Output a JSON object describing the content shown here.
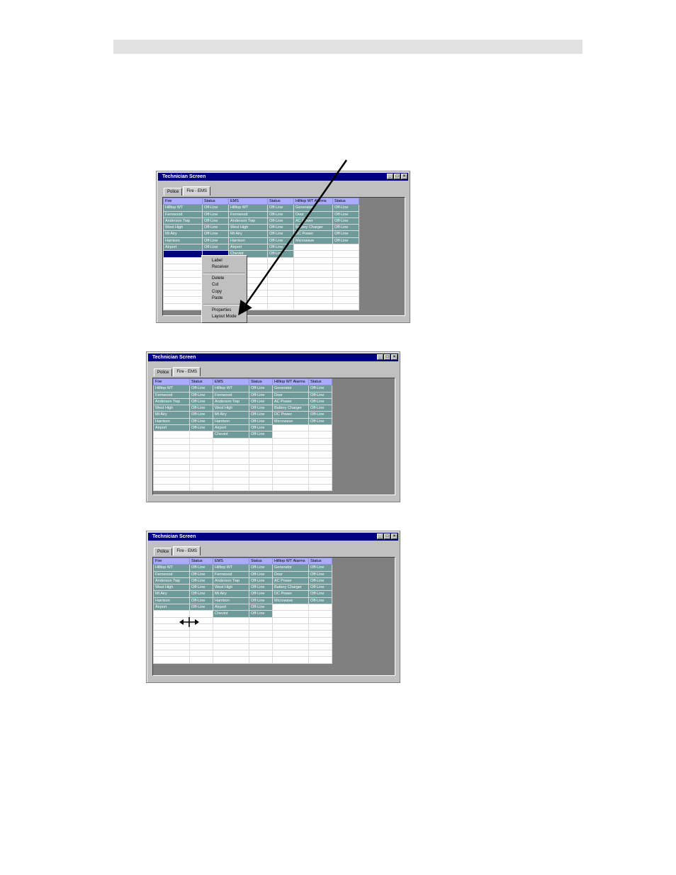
{
  "windows": [
    {
      "title": "Technician Screen",
      "tabs": [
        "Police",
        "Fire - EMS"
      ],
      "active_tab": 1,
      "headers": [
        "Fire",
        "Status",
        "EMS",
        "Status",
        "Hilltop WT Alarms",
        "Status"
      ],
      "col1": [
        "Hilltop WT",
        "Fernwood",
        "Anderson Twp",
        "West High",
        "Mt Airy",
        "Harrison",
        "Airport"
      ],
      "col3": [
        "Hilltop WT",
        "Fernwood",
        "Anderson Twp",
        "West High",
        "Mt Airy",
        "Harrison",
        "Airport",
        "Cheviot"
      ],
      "col5": [
        "Generator",
        "Door",
        "AC Power",
        "Battery Charger",
        "DC Power",
        "Microwave"
      ],
      "status": "Off-Line"
    },
    {
      "title": "Technician Screen",
      "tabs": [
        "Police",
        "Fire - EMS"
      ],
      "active_tab": 1,
      "headers": [
        "Fire",
        "Status",
        "EMS",
        "Status",
        "Hilltop WT Alarms",
        "Status"
      ],
      "col1": [
        "Hilltop WT",
        "Fernwood",
        "Anderson Twp",
        "West High",
        "Mt Airy",
        "Harrison",
        "Airport"
      ],
      "col3": [
        "Hilltop WT",
        "Fernwood",
        "Anderson Twp",
        "West High",
        "Mt Airy",
        "Harrison",
        "Airport",
        "Cheviot"
      ],
      "col5": [
        "Generator",
        "Door",
        "AC Power",
        "Battery Charger",
        "DC Power",
        "Microwave"
      ],
      "status": "Off-Line"
    },
    {
      "title": "Technician Screen",
      "tabs": [
        "Police",
        "Fire - EMS"
      ],
      "active_tab": 1,
      "headers": [
        "Fire",
        "Status",
        "EMS",
        "Status",
        "Hilltop WT Alarms",
        "Status"
      ],
      "col1": [
        "Hilltop WT",
        "Fernwood",
        "Anderson Twp",
        "West High",
        "Mt Airy",
        "Harrison",
        "Airport"
      ],
      "col3": [
        "Hilltop WT",
        "Fernwood",
        "Anderson Twp",
        "West High",
        "Mt Airy",
        "Harrison",
        "Airport",
        "Cheviot"
      ],
      "col5": [
        "Generator",
        "Door",
        "AC Power",
        "Battery Charger",
        "DC Power",
        "Microwave"
      ],
      "status": "Off-Line"
    }
  ],
  "context_menu": {
    "label": "Label",
    "receiver": "Receiver",
    "delete": "Delete",
    "cut": "Cut",
    "copy": "Copy",
    "paste": "Paste",
    "properties": "Properties",
    "layout_mode": "Layout Mode"
  },
  "colors": {
    "title_bar": "#000080",
    "header_cell": "#aaaaff",
    "data_cell": "#6e9a9a",
    "empty_area": "#808080"
  }
}
